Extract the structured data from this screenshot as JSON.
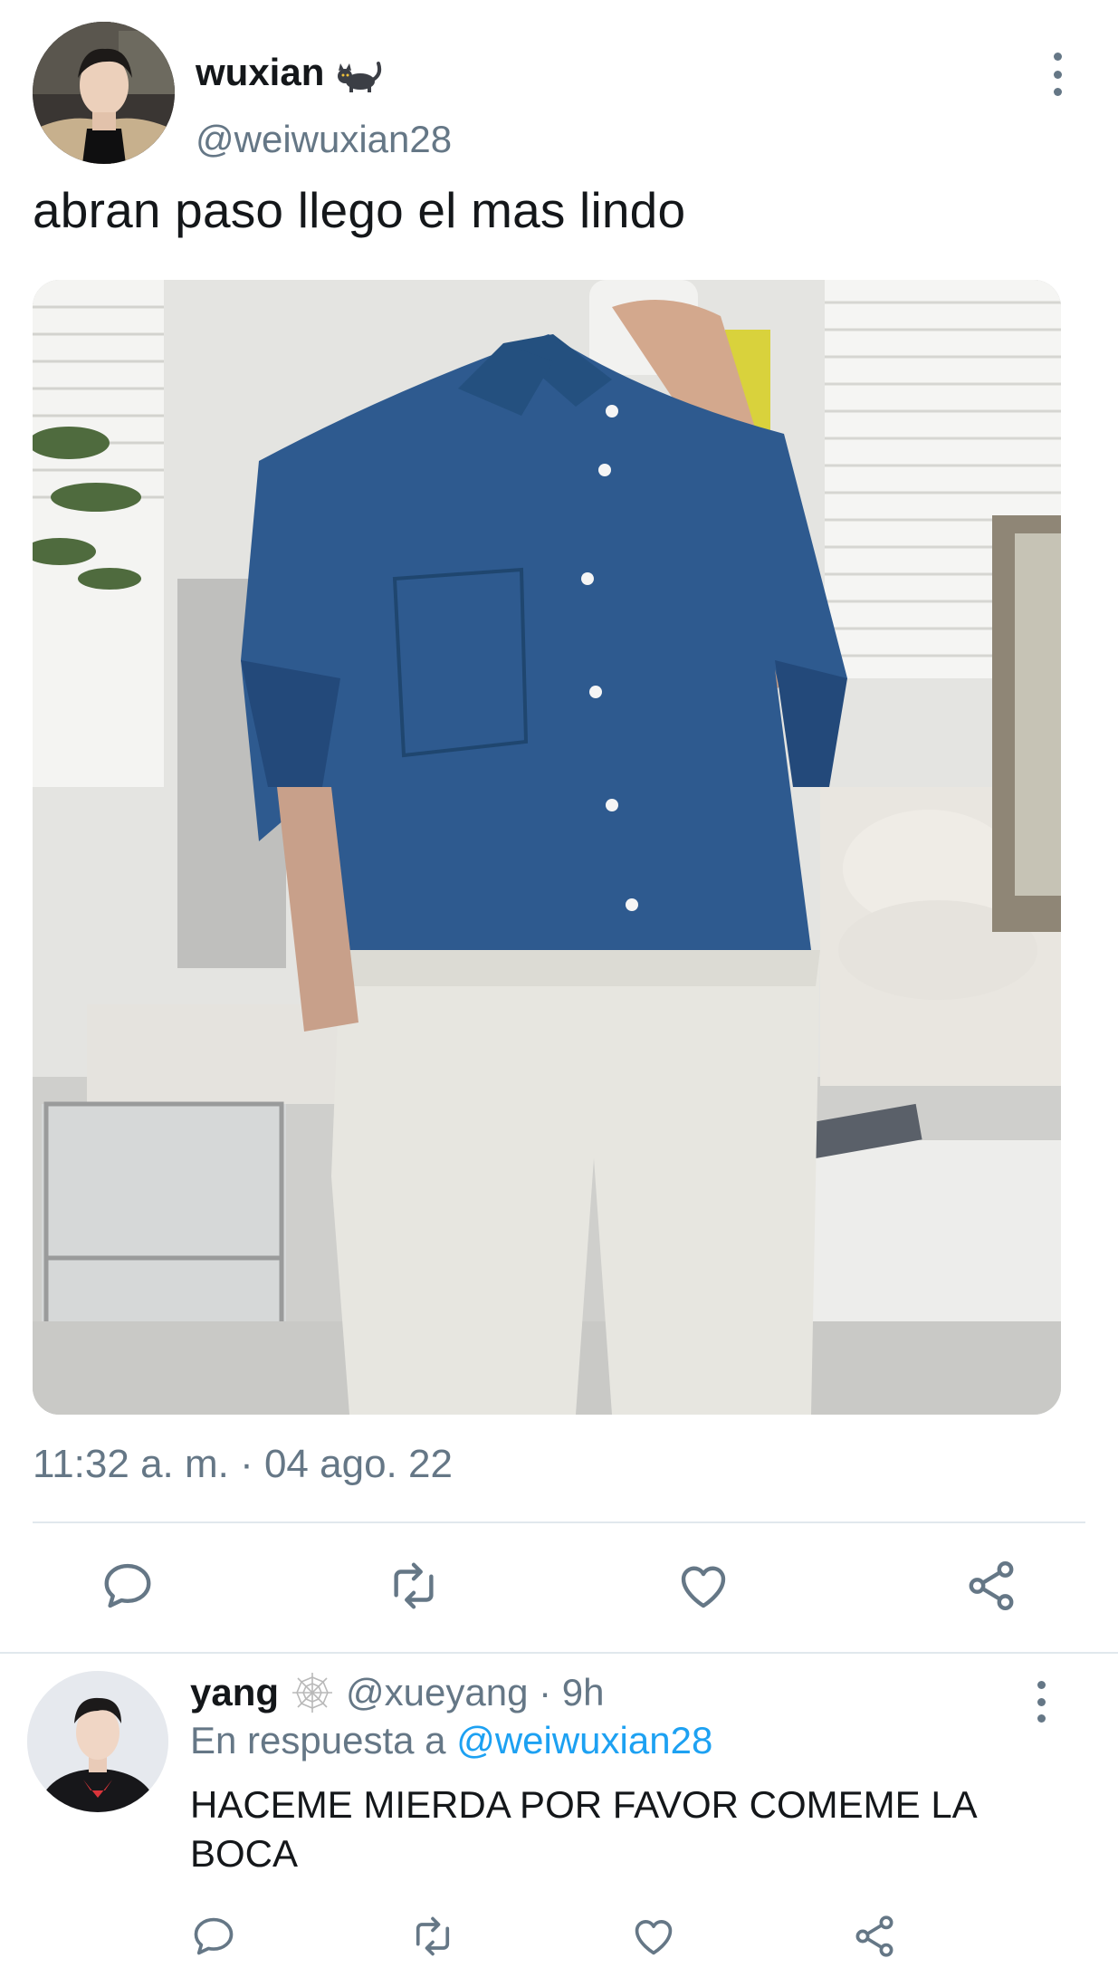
{
  "tweet": {
    "author_name": "wuxian",
    "author_handle": "@weiwuxian28",
    "text": "abran paso llego el mas lindo",
    "timestamp": "11:32 a. m. · 04 ago. 22"
  },
  "reply": {
    "author_name": "yang",
    "meta": "@xueyang · 9h",
    "in_reply_prefix": "En respuesta a",
    "in_reply_handle": "@weiwuxian28",
    "text": "HACEME MIERDA POR FAVOR COMEME LA BOCA"
  },
  "icons": {
    "author_emoji": "black-cat-icon",
    "reply_emoji": "spider-web-icon",
    "actions": [
      "reply-icon",
      "retweet-icon",
      "like-icon",
      "share-icon"
    ]
  },
  "colors": {
    "text_primary": "#14171a",
    "text_secondary": "#657786",
    "link": "#1da1f2",
    "divider": "#e1e8ed"
  }
}
